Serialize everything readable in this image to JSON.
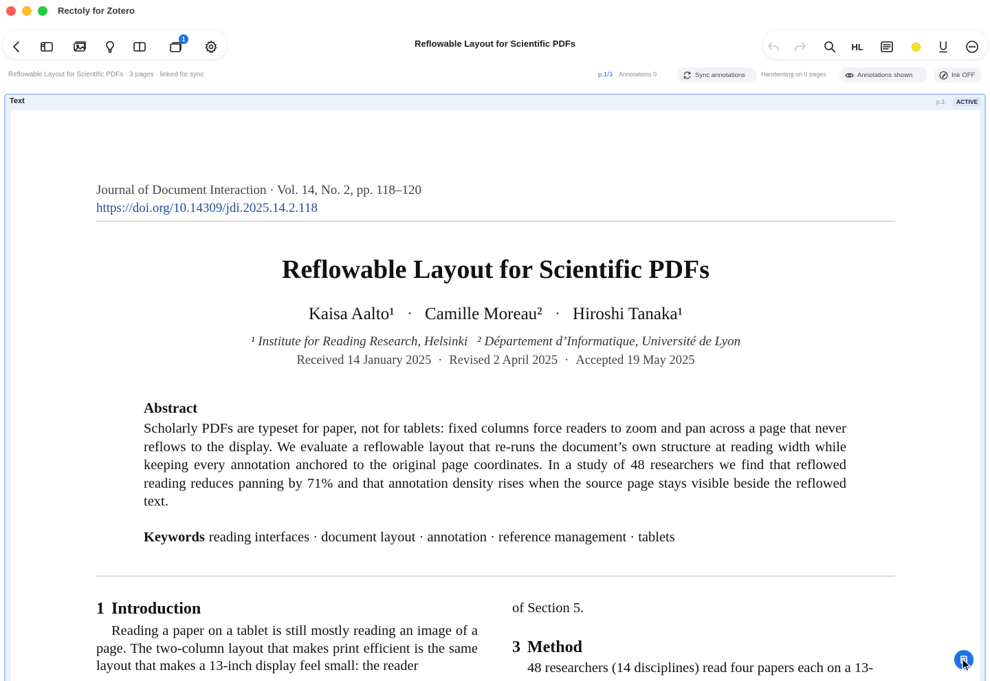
{
  "window": {
    "title": "Rectoly for Zotero"
  },
  "toolbar": {
    "doc_title": "Reflowable Layout for Scientific PDFs",
    "left_buttons": [
      {
        "name": "back-button",
        "icon": "chevron-left-icon"
      },
      {
        "name": "sidebar-toggle-button",
        "icon": "sidebar-icon"
      },
      {
        "name": "image-view-button",
        "icon": "photo-stack-icon"
      },
      {
        "name": "insights-button",
        "icon": "lightbulb-icon"
      },
      {
        "name": "split-view-button",
        "icon": "columns-icon"
      },
      {
        "name": "pages-button",
        "icon": "pages-stack-icon",
        "badge": "1"
      },
      {
        "name": "settings-button",
        "icon": "gear-icon"
      }
    ],
    "right_buttons": [
      {
        "name": "undo-button",
        "icon": "undo-icon",
        "enabled": false
      },
      {
        "name": "redo-button",
        "icon": "redo-icon",
        "enabled": false
      },
      {
        "name": "search-button",
        "icon": "search-icon"
      },
      {
        "name": "highlight-button",
        "label": "HL"
      },
      {
        "name": "reader-mode-button",
        "icon": "text-panel-icon"
      },
      {
        "name": "color-button",
        "icon": "color-dot-icon",
        "color": "#f5e61a"
      },
      {
        "name": "underline-button",
        "label": "U"
      },
      {
        "name": "more-button",
        "icon": "ellipsis-circle-icon"
      }
    ]
  },
  "statusbar": {
    "doc_meta": "Reflowable Layout for Scientific PDFs · 3 pages · linked for sync",
    "page_indicator": "p.1/3",
    "annotations": "Annotations 0",
    "sync_label": "Sync annotations",
    "handwriting": "Handwriting on 0 pages",
    "annotations_shown_label": "Annotations shown",
    "ink_label": "Ink OFF"
  },
  "frame": {
    "label": "Text",
    "page": "p.1",
    "status": "ACTIVE",
    "accent": "#a9c8f0"
  },
  "paper": {
    "journal": "Journal of Document Interaction  ·  Vol. 14, No. 2, pp. 118–120",
    "doi": "https://doi.org/10.14309/jdi.2025.14.2.118",
    "title": "Reflowable Layout for Scientific PDFs",
    "authors": [
      "Kaisa Aalto¹",
      "Camille Moreau²",
      "Hiroshi Tanaka¹"
    ],
    "author_sep": "·",
    "affiliations": [
      "¹ Institute for Reading Research, Helsinki",
      "² Département d’Informatique, Université de Lyon"
    ],
    "dates": [
      "Received 14 January 2025",
      "Revised 2 April 2025",
      "Accepted 19 May 2025"
    ],
    "date_sep": "·",
    "abstract_heading": "Abstract",
    "abstract": "Scholarly PDFs are typeset for paper, not for tablets: fixed columns force readers to zoom and pan across a page that never reflows to the display. We evaluate a reflowable layout that re-runs the document’s own structure at reading width while keeping every annotation anchored to the original page coordinates. In a study of 48 researchers we find that reflowed reading reduces panning by 71% and that annotation density rises when the source page stays visible beside the reflowed text.",
    "keywords_label": "Keywords",
    "keywords": "reading interfaces · document layout · annotation · reference management · tablets",
    "sections": {
      "intro_num": "1",
      "intro_title": "Introduction",
      "intro_text": "Reading a paper on a tablet is still mostly reading an image of a page. The two-column layout that makes print efficient is the same layout that makes a 13-inch display feel small: the reader",
      "right_cont": "of Section 5.",
      "method_num": "3",
      "method_title": "Method",
      "method_text": "48 researchers (14 disciplines) read four papers each on a 13-"
    }
  }
}
